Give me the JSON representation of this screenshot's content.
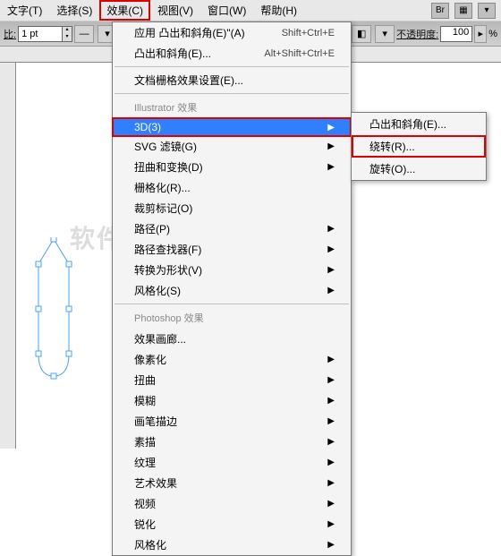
{
  "menubar": {
    "items": [
      "文字(T)",
      "选择(S)",
      "效果(C)",
      "视图(V)",
      "窗口(W)",
      "帮助(H)"
    ],
    "hl_index": 2,
    "br": "Br"
  },
  "toolbar": {
    "stroke_label": "比:",
    "stroke_value": "1 pt",
    "opacity_label": "不透明度:",
    "opacity_value": "100",
    "opacity_unit": "%"
  },
  "dropdown": {
    "top": [
      {
        "label": "应用 凸出和斜角(E)\"(A)",
        "shortcut": "Shift+Ctrl+E"
      },
      {
        "label": "凸出和斜角(E)...",
        "shortcut": "Alt+Shift+Ctrl+E"
      }
    ],
    "doc_raster": "文档栅格效果设置(E)...",
    "header1": "Illustrator 效果",
    "group1": [
      {
        "label": "3D(3)",
        "selected": true,
        "hl": true,
        "sub": true
      },
      {
        "label": "SVG 滤镜(G)",
        "sub": true
      },
      {
        "label": "扭曲和变换(D)",
        "sub": true
      },
      {
        "label": "栅格化(R)..."
      },
      {
        "label": "裁剪标记(O)"
      },
      {
        "label": "路径(P)",
        "sub": true
      },
      {
        "label": "路径查找器(F)",
        "sub": true
      },
      {
        "label": "转换为形状(V)",
        "sub": true
      },
      {
        "label": "风格化(S)",
        "sub": true
      }
    ],
    "header2": "Photoshop 效果",
    "group2": [
      {
        "label": "效果画廊...",
        "sub": false
      },
      {
        "label": "像素化",
        "sub": true
      },
      {
        "label": "扭曲",
        "sub": true
      },
      {
        "label": "模糊",
        "sub": true
      },
      {
        "label": "画笔描边",
        "sub": true
      },
      {
        "label": "素描",
        "sub": true
      },
      {
        "label": "纹理",
        "sub": true
      },
      {
        "label": "艺术效果",
        "sub": true
      },
      {
        "label": "视频",
        "sub": true
      },
      {
        "label": "锐化",
        "sub": true
      },
      {
        "label": "风格化",
        "sub": true
      }
    ]
  },
  "submenu": {
    "items": [
      {
        "label": "凸出和斜角(E)..."
      },
      {
        "label": "绕转(R)...",
        "hl": true
      },
      {
        "label": "旋转(O)..."
      }
    ]
  },
  "watermark": "软件自学网"
}
